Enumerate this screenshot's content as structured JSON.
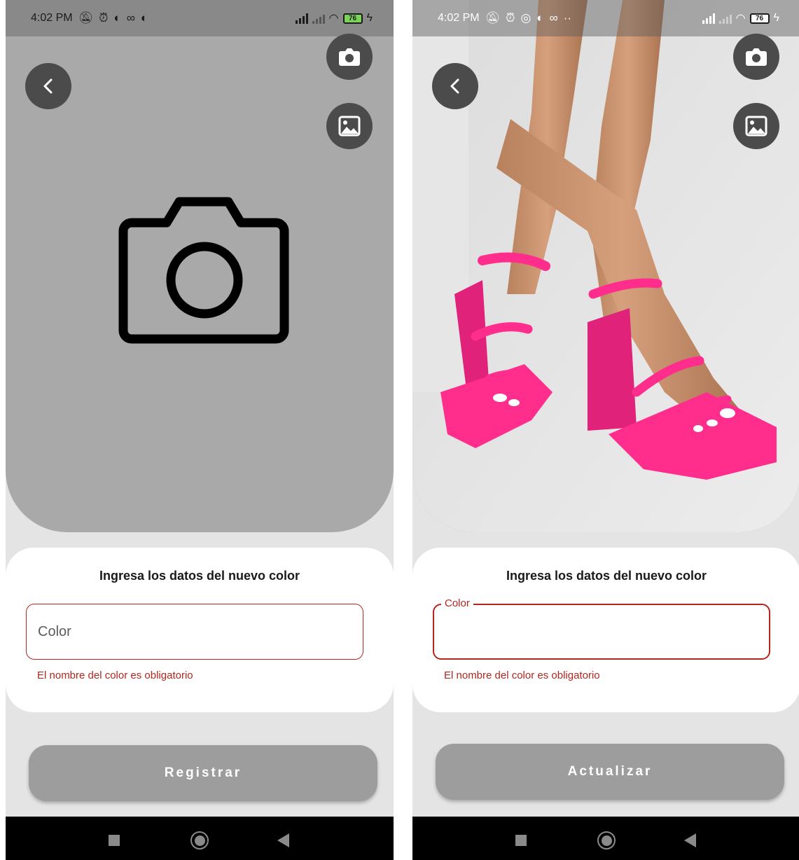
{
  "screens": [
    {
      "status": {
        "time": "4:02 PM",
        "icons": [
          "mute-icon",
          "alarm-icon",
          "app-icon",
          "voicemail-icon",
          "app-icon"
        ],
        "battery": "76"
      },
      "card_title": "Ingresa los datos del nuevo color",
      "field": {
        "label": "Color",
        "value": ""
      },
      "error": "El nombre del color es obligatorio",
      "button_label": "Registrar",
      "image": "camera-placeholder-icon"
    },
    {
      "status": {
        "time": "4:02 PM",
        "icons": [
          "mute-icon",
          "alarm-icon",
          "whatsapp-icon",
          "app-icon",
          "voicemail-icon",
          "more-dots-icon"
        ],
        "battery": "76"
      },
      "card_title": "Ingresa los datos del nuevo color",
      "field": {
        "label": "Color",
        "value": ""
      },
      "error": "El nombre del color es obligatorio",
      "button_label": "Actualizar",
      "image": "product-photo-pink-platform-sandals"
    }
  ],
  "colors": {
    "error": "#b3261e",
    "button": "#9d9d9d",
    "hero_bg": "#a9a9a9",
    "product": "#ff2e8c"
  }
}
